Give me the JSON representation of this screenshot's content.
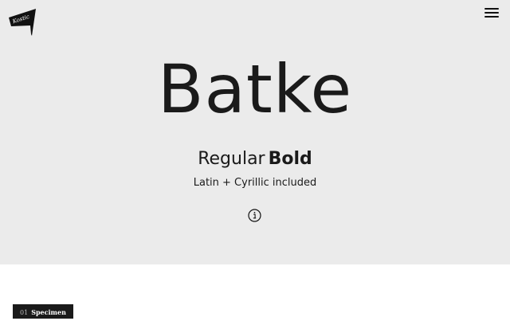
{
  "header": {
    "logo": {
      "icon": "pennant-logo-icon",
      "text": "Kostic"
    },
    "menu": {
      "icon": "hamburger-menu-icon"
    }
  },
  "hero": {
    "font_name": "Batke",
    "weights": {
      "regular": "Regular",
      "bold": "Bold"
    },
    "scripts": "Latin + Cyrillic included",
    "info": {
      "icon": "info-icon"
    }
  },
  "sections": [
    {
      "number": "01",
      "label": "Specimen"
    }
  ],
  "colors": {
    "hero_background": "#ebebeb",
    "page_background": "#ffffff",
    "text": "#1a1a1a",
    "tab_background": "#1a1a1a",
    "tab_text": "#ffffff"
  }
}
